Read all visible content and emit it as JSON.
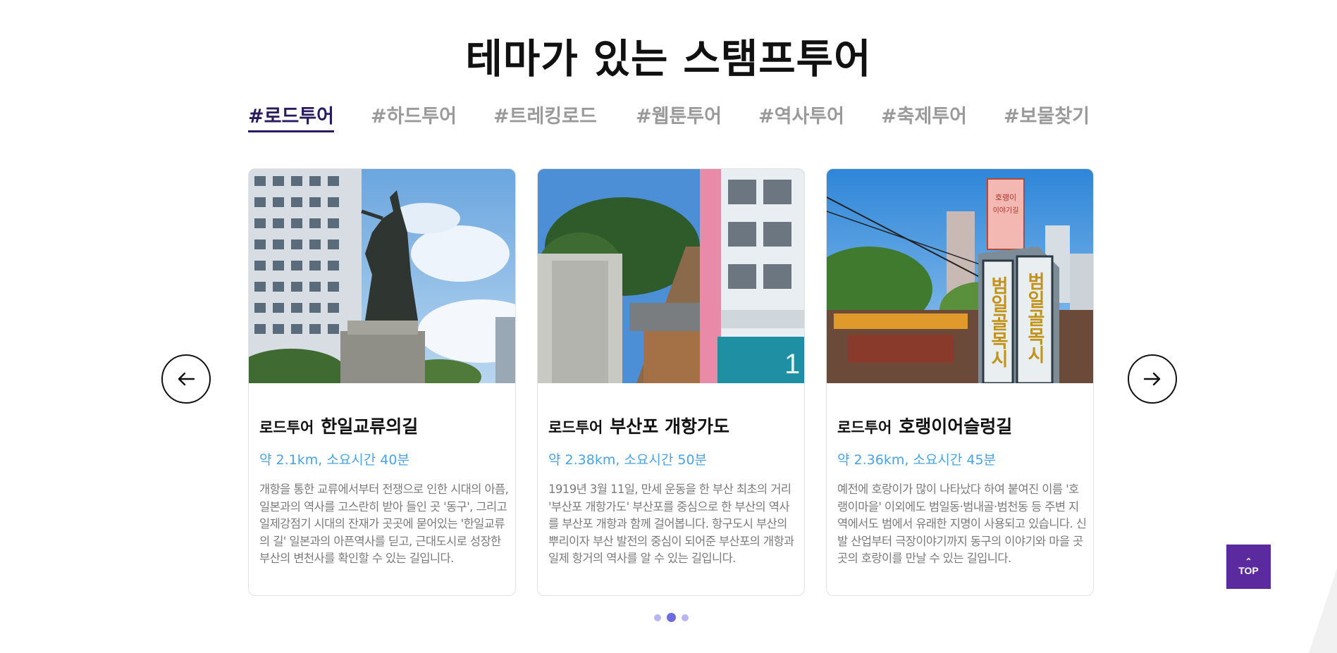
{
  "page_title": "테마가 있는 스탬프투어",
  "tabs": [
    {
      "label": "#로드투어",
      "active": true
    },
    {
      "label": "#하드투어",
      "active": false
    },
    {
      "label": "#트레킹로드",
      "active": false
    },
    {
      "label": "#웹툰투어",
      "active": false
    },
    {
      "label": "#역사투어",
      "active": false
    },
    {
      "label": "#축제투어",
      "active": false
    },
    {
      "label": "#보물찾기",
      "active": false
    }
  ],
  "cards": [
    {
      "prefix": "로드투어",
      "name": "한일교류의길",
      "meta": "약 2.1km, 소요시간 40분",
      "desc": "개항을 통한 교류에서부터 전쟁으로 인한 시대의 아픔, 일본과의 역사를 고스란히 받아 들인 곳 '동구', 그리고 일제강점기 시대의 잔재가 곳곳에 묻어있는 '한일교류의 길' 일본과의 아픈역사를 딛고, 근대도시로 성장한 부산의 변천사를 확인할 수 있는 길입니다."
    },
    {
      "prefix": "로드투어",
      "name": "부산포 개항가도",
      "meta": "약 2.38km, 소요시간 50분",
      "desc": "1919년 3월 11일, 만세 운동을 한 부산 최초의 거리 '부산포 개항가도' 부산포를 중심으로 한 부산의 역사를 부산포 개항과 함께 걸어봅니다. 항구도시 부산의 뿌리이자 부산 발전의 중심이 되어준 부산포의 개항과 일제 항거의 역사를 알 수 있는 길입니다."
    },
    {
      "prefix": "로드투어",
      "name": "호랭이어슬렁길",
      "meta": "약 2.36km, 소요시간 45분",
      "desc": "예전에 호랑이가 많이 나타났다 하여 붙여진 이름 '호랭이마을' 이외에도 범일동·범내골·범천동 등 주변 지역에서도 범에서 유래한 지명이 사용되고 있습니다. 신발 산업부터 극장이야기까지 동구의 이야기와 마을 곳곳의 호랑이를 만날 수 있는 길입니다."
    }
  ],
  "sign_text": {
    "line1": "호랭이",
    "line2": "이야기길",
    "pillar_left": "범일골목시",
    "pillar_right": "범일골목시"
  },
  "slider": {
    "dot_count": 3,
    "active_index": 1
  },
  "top_button": "TOP",
  "colors": {
    "accent": "#5b2a9e",
    "active_tab": "#2a1a5e",
    "meta": "#4aa3e6",
    "dot_active": "#6f6ae0",
    "dot": "#b9b6f0"
  }
}
